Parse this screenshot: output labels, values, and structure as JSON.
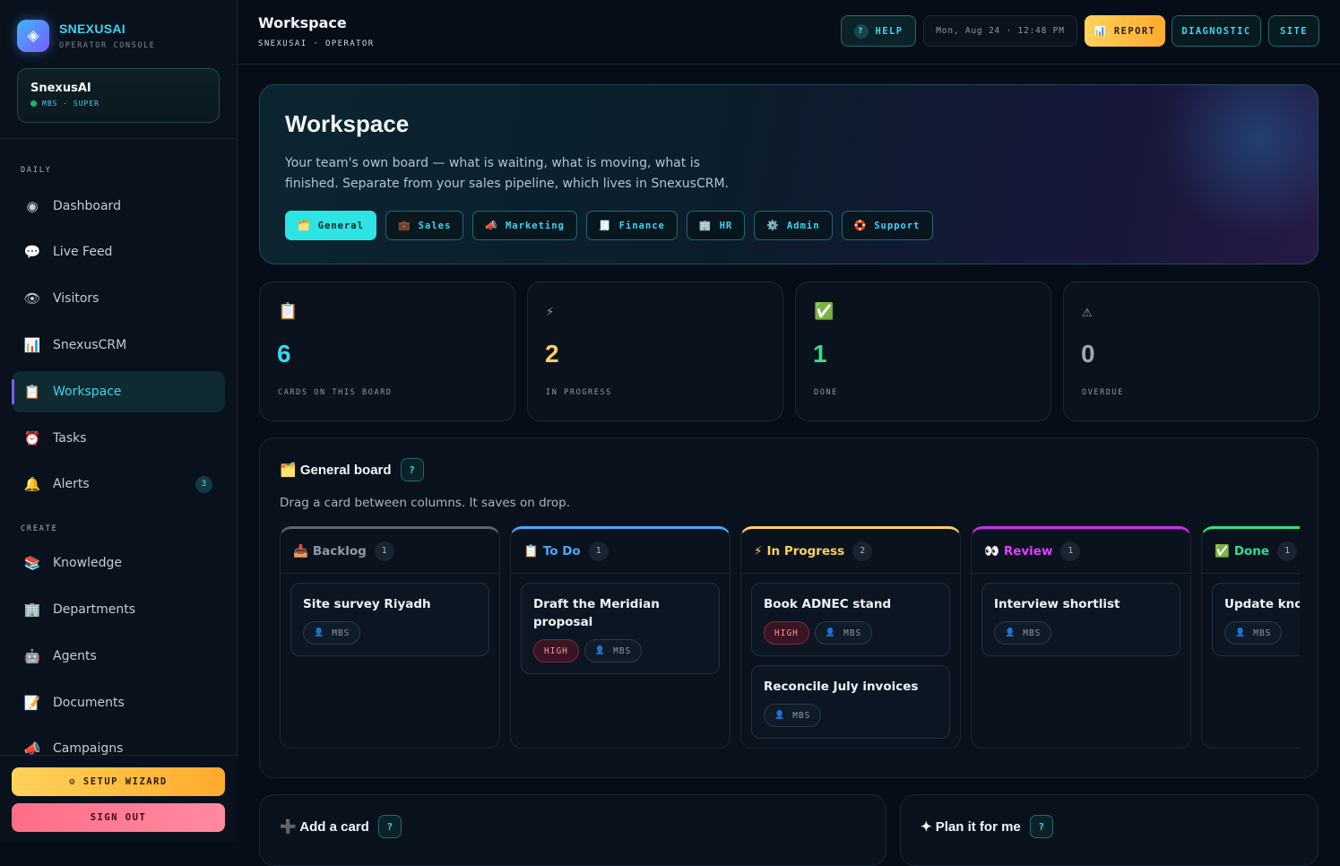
{
  "brand": {
    "name": "SNEXUSAI",
    "subtitle": "OPERATOR CONSOLE",
    "logo_icon": "diamond-icon"
  },
  "org": {
    "name": "SnexusAI",
    "meta": "MBS · SUPER",
    "status_color": "#1fb26b"
  },
  "sidebar": {
    "sections": [
      {
        "label": "DAILY",
        "items": [
          {
            "icon": "◉",
            "label": "Dashboard"
          },
          {
            "icon": "💬",
            "label": "Live Feed"
          },
          {
            "icon": "👁",
            "label": "Visitors"
          },
          {
            "icon": "📊",
            "label": "SnexusCRM"
          },
          {
            "icon": "📋",
            "label": "Workspace",
            "active": true
          },
          {
            "icon": "⏰",
            "label": "Tasks"
          },
          {
            "icon": "🔔",
            "label": "Alerts",
            "badge": "3"
          }
        ]
      },
      {
        "label": "CREATE",
        "items": [
          {
            "icon": "📚",
            "label": "Knowledge"
          },
          {
            "icon": "🏢",
            "label": "Departments"
          },
          {
            "icon": "🤖",
            "label": "Agents"
          },
          {
            "icon": "📝",
            "label": "Documents"
          },
          {
            "icon": "📣",
            "label": "Campaigns"
          }
        ]
      }
    ],
    "setup_label": "⚙ SETUP WIZARD",
    "signout_label": "SIGN OUT"
  },
  "topbar": {
    "title": "Workspace",
    "crumb": "SNEXUSAI · OPERATOR",
    "help_label": "HELP",
    "date": "Mon, Aug 24 · 12:48 PM",
    "report_label": "📊 REPORT",
    "diagnostic_label": "DIAGNOSTIC",
    "site_label": "SITE"
  },
  "hero": {
    "title": "Workspace",
    "description": "Your team's own board — what is waiting, what is moving, what is finished. Separate from your sales pipeline, which lives in SnexusCRM.",
    "tabs": [
      {
        "icon": "🗂️",
        "label": "General",
        "active": true
      },
      {
        "icon": "💼",
        "label": "Sales"
      },
      {
        "icon": "📣",
        "label": "Marketing"
      },
      {
        "icon": "🧾",
        "label": "Finance"
      },
      {
        "icon": "🏢",
        "label": "HR"
      },
      {
        "icon": "⚙️",
        "label": "Admin"
      },
      {
        "icon": "🛟",
        "label": "Support"
      }
    ]
  },
  "stats": [
    {
      "icon": "📋",
      "value": "6",
      "label": "CARDS ON THIS BOARD",
      "color": "#3ad6f0"
    },
    {
      "icon": "⚡",
      "value": "2",
      "label": "IN PROGRESS",
      "color": "#ffd25a"
    },
    {
      "icon": "✅",
      "value": "1",
      "label": "DONE",
      "color": "#2fe08a"
    },
    {
      "icon": "⚠",
      "value": "0",
      "label": "OVERDUE",
      "color": "#9aa6b3"
    }
  ],
  "board": {
    "title": "🗂️ General board",
    "help": "?",
    "subtitle": "Drag a card between columns. It saves on drop.",
    "columns": [
      {
        "icon": "📥",
        "name": "Backlog",
        "count": "1",
        "color": "#8e9aa6",
        "accent": "#5a6675",
        "cards": [
          {
            "title": "Site survey Riyadh",
            "tags": [
              "MBS"
            ]
          }
        ]
      },
      {
        "icon": "📋",
        "name": "To Do",
        "count": "1",
        "color": "#4aa8ff",
        "accent": "#4aa8ff",
        "cards": [
          {
            "title": "Draft the Meridian proposal",
            "priority": "HIGH",
            "tags": [
              "MBS"
            ]
          }
        ]
      },
      {
        "icon": "⚡",
        "name": "In Progress",
        "count": "2",
        "color": "#ffd25a",
        "accent": "#ffd25a",
        "cards": [
          {
            "title": "Book ADNEC stand",
            "priority": "HIGH",
            "tags": [
              "MBS"
            ]
          },
          {
            "title": "Reconcile July invoices",
            "tags": [
              "MBS"
            ]
          }
        ]
      },
      {
        "icon": "👀",
        "name": "Review",
        "count": "1",
        "color": "#e040ff",
        "accent": "#d12cf0",
        "cards": [
          {
            "title": "Interview shortlist",
            "tags": [
              "MBS"
            ]
          }
        ]
      },
      {
        "icon": "✅",
        "name": "Done",
        "count": "1",
        "color": "#2fe08a",
        "accent": "#2fe08a",
        "cards": [
          {
            "title": "Update knowledge base",
            "tags": [
              "MBS"
            ]
          }
        ]
      }
    ]
  },
  "panels": [
    {
      "title": "➕ Add a card",
      "help": "?"
    },
    {
      "title": "✦ Plan it for me",
      "help": "?"
    }
  ]
}
